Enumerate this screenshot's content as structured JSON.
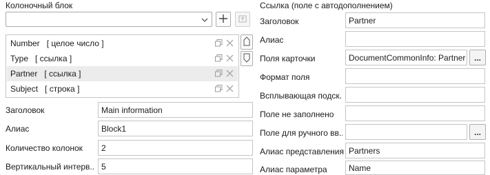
{
  "left": {
    "section_title": "Колоночный блок",
    "combo_value": "",
    "columns": [
      {
        "name": "Number",
        "type": "[ целое число ]",
        "selected": false
      },
      {
        "name": "Type",
        "type": "[ ссылка ]",
        "selected": false
      },
      {
        "name": "Partner",
        "type": "[ ссылка ]",
        "selected": true
      },
      {
        "name": "Subject",
        "type": "[ строка ]",
        "selected": false
      }
    ],
    "fields": [
      {
        "label": "Заголовок",
        "value": "Main information"
      },
      {
        "label": "Алиас",
        "value": "Block1"
      },
      {
        "label": "Количество колонок",
        "value": "2"
      },
      {
        "label": "Вертикальный интерв...",
        "value": "5"
      }
    ]
  },
  "right": {
    "section_title": "Ссылка (поле с автодополнением)",
    "fields": [
      {
        "label": "Заголовок",
        "value": ""
      },
      {
        "label": "Алиас",
        "value": ""
      },
      {
        "label": "Поля карточки",
        "value": "DocumentCommonInfo: Partner"
      },
      {
        "label": "Формат поля",
        "value": ""
      },
      {
        "label": "Всплывающая подск...",
        "value": ""
      },
      {
        "label": "Поле не заполнено",
        "value": ""
      },
      {
        "label": "Поле для ручного вв...",
        "value": ""
      },
      {
        "label": "Алиас представления",
        "value": "Partners"
      },
      {
        "label": "Алиас параметра",
        "value": "Name"
      }
    ],
    "header_value": "Partner",
    "browse_button_label": "..."
  },
  "colors": {
    "border": "#c4c4c4",
    "selected_row": "#ececec",
    "icon_gray": "#9a9a9a"
  }
}
